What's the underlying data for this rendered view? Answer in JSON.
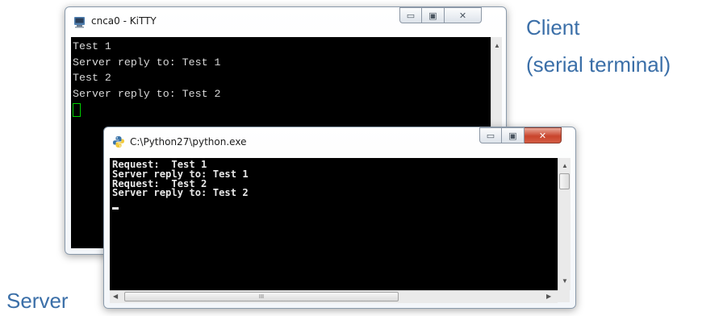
{
  "captions": {
    "client_line1": "Client",
    "client_line2": "(serial terminal)",
    "server": "Server"
  },
  "kitty_window": {
    "title": "cnca0 - KiTTY",
    "icon": "kitty-terminal-icon",
    "buttons": {
      "minimize": "▭",
      "maximize": "▣",
      "close": "✕"
    },
    "lines": [
      "Test 1",
      "Server reply to: Test 1",
      "Test 2",
      "Server reply to: Test 2"
    ]
  },
  "python_window": {
    "title": "C:\\Python27\\python.exe",
    "icon": "python-icon",
    "buttons": {
      "minimize": "▭",
      "maximize": "▣",
      "close": "✕"
    },
    "lines": [
      "Request:  Test 1",
      "Server reply to: Test 1",
      "Request:  Test 2",
      "Server reply to: Test 2"
    ],
    "hscroll_thumb_grip": "III"
  },
  "colors": {
    "caption_text": "#3b6fa8",
    "kitty_cursor": "#00d000",
    "close_button_red": "#c9442c"
  }
}
